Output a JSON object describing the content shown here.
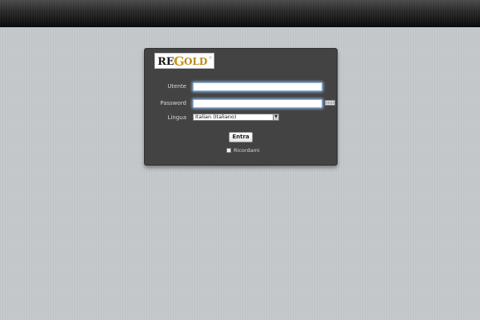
{
  "header": {
    "bar": "top-bar"
  },
  "logo": {
    "text_re": "RE",
    "text_g": "G",
    "text_old": "OLD",
    "icon": "regold-logo-icon",
    "colors": {
      "re": "#1a1a1a",
      "g": "#c89a1c",
      "old": "#b8891a"
    }
  },
  "login": {
    "username_label": "Utente",
    "username_value": "",
    "password_label": "Password",
    "password_value": "",
    "language_label": "Lingua",
    "language_selected": "Italian (Italiano)",
    "submit_label": "Entra",
    "remember_label": "Ricordami",
    "remember_checked": false,
    "keyboard_icon": "virtual-keyboard-icon"
  },
  "colors": {
    "background": "#c4c8ca",
    "panel": "#434343",
    "input_glow": "#96c8ff"
  }
}
